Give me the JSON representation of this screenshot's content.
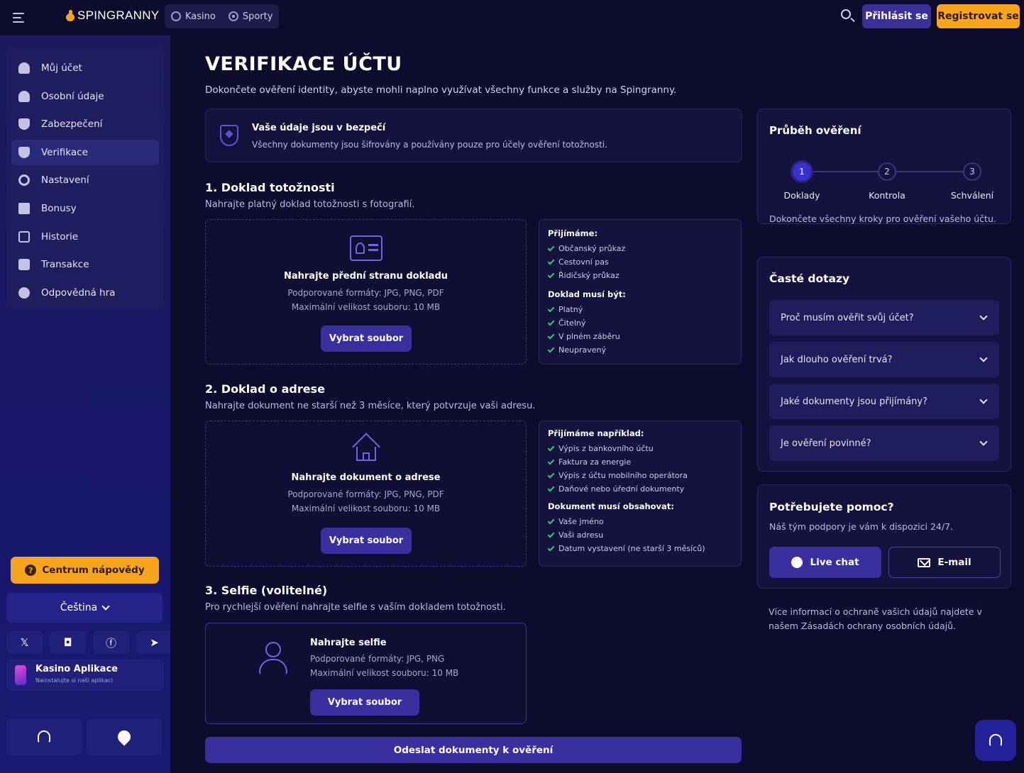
{
  "header": {
    "logo_text": "SPINGRANNY",
    "nav": [
      {
        "label": "Kasino",
        "icon": "chip-icon"
      },
      {
        "label": "Sporty",
        "icon": "ball-icon"
      }
    ],
    "login_label": "Přihlásit se",
    "register_label": "Registrovat se"
  },
  "sidebar": {
    "items": [
      {
        "label": "Můj účet",
        "icon": "user-icon"
      },
      {
        "label": "Osobní údaje",
        "icon": "user-icon"
      },
      {
        "label": "Zabezpečení",
        "icon": "shield-icon"
      },
      {
        "label": "Verifikace",
        "icon": "verify-shield-icon",
        "active": true
      },
      {
        "label": "Nastavení",
        "icon": "gear-icon"
      },
      {
        "label": "Bonusy",
        "icon": "gift-icon"
      },
      {
        "label": "Historie",
        "icon": "history-icon"
      },
      {
        "label": "Transakce",
        "icon": "card-icon"
      },
      {
        "label": "Odpovědná hra",
        "icon": "responsible-gaming-icon"
      }
    ],
    "help_center_label": "Centrum nápovědy",
    "language_label": "Čeština",
    "socials": [
      "x-icon",
      "instagram-icon",
      "facebook-icon",
      "telegram-icon"
    ],
    "app": {
      "title": "Kasino Aplikace",
      "subtitle": "Nainstalujte si naši aplikaci"
    }
  },
  "main": {
    "title": "VERIFIKACE ÚČTU",
    "subtitle": "Dokončete ověření identity, abyste mohli naplno využívat všechny funkce a služby na Spingranny.",
    "security": {
      "title": "Vaše údaje jsou v bezpečí",
      "text": "Všechny dokumenty jsou šifrovány a používány pouze pro účely ověření totožnosti."
    },
    "section1": {
      "heading": "1. Doklad totožnosti",
      "desc": "Nahrajte platný doklad totožnosti s fotografií.",
      "upload_title": "Nahrajte přední stranu dokladu",
      "formats": "Podporované formáty: JPG, PNG, PDF",
      "max_size": "Maximální velikost souboru: 10 MB",
      "button": "Vybrat soubor",
      "accept_head": "Přijímáme:",
      "accept_items": [
        "Občanský průkaz",
        "Cestovní pas",
        "Řidičský průkaz"
      ],
      "must_head": "Doklad musí být:",
      "must_items": [
        "Platný",
        "Čitelný",
        "V plném záběru",
        "Neupravený"
      ]
    },
    "section2": {
      "heading": "2. Doklad o adrese",
      "desc": "Nahrajte dokument ne starší než 3 měsíce, který potvrzuje vaši adresu.",
      "upload_title": "Nahrajte dokument o adrese",
      "formats": "Podporované formáty: JPG, PNG, PDF",
      "max_size": "Maximální velikost souboru: 10 MB",
      "button": "Vybrat soubor",
      "accept_head": "Přijímáme například:",
      "accept_items": [
        "Výpis z bankovního účtu",
        "Faktura za energie",
        "Výpis z účtu mobilního operátora",
        "Daňové nebo úřední dokumenty"
      ],
      "must_head": "Dokument musí obsahovat:",
      "must_items": [
        "Vaše jméno",
        "Vaši adresu",
        "Datum vystavení (ne starší 3 měsíců)"
      ]
    },
    "section3": {
      "heading": "3. Selfie (volitelné)",
      "desc": "Pro rychlejší ověření nahrajte selfie s vaším dokladem totožnosti.",
      "upload_title": "Nahrajte selfie",
      "formats": "Podporované formáty: JPG, PNG",
      "max_size": "Maximální velikost souboru: 10 MB",
      "button": "Vybrat soubor"
    },
    "submit_label": "Odeslat dokumenty k ověření"
  },
  "progress": {
    "title": "Průběh ověření",
    "steps": [
      {
        "number": "1",
        "label": "Doklady"
      },
      {
        "number": "2",
        "label": "Kontrola"
      },
      {
        "number": "3",
        "label": "Schválení"
      }
    ],
    "text": "Dokončete všechny kroky pro ověření vašeho účtu."
  },
  "faq": {
    "title": "Časté dotazy",
    "items": [
      "Proč musím ověřit svůj účet?",
      "Jak dlouho ověření trvá?",
      "Jaké dokumenty jsou přijímány?",
      "Je ověření povinné?"
    ]
  },
  "help": {
    "title": "Potřebujete pomoc?",
    "text": "Náš tým podpory je vám k dispozici 24/7.",
    "live_chat_label": "Live chat",
    "email_label": "E-mail"
  },
  "privacy_text": "Více informací o ochraně vašich údajů najdete v našem Zásadách ochrany osobních údajů.",
  "colors": {
    "accent": "#3a2f9e",
    "brand_orange": "#f7a51d",
    "check_green": "#3ec46d"
  }
}
